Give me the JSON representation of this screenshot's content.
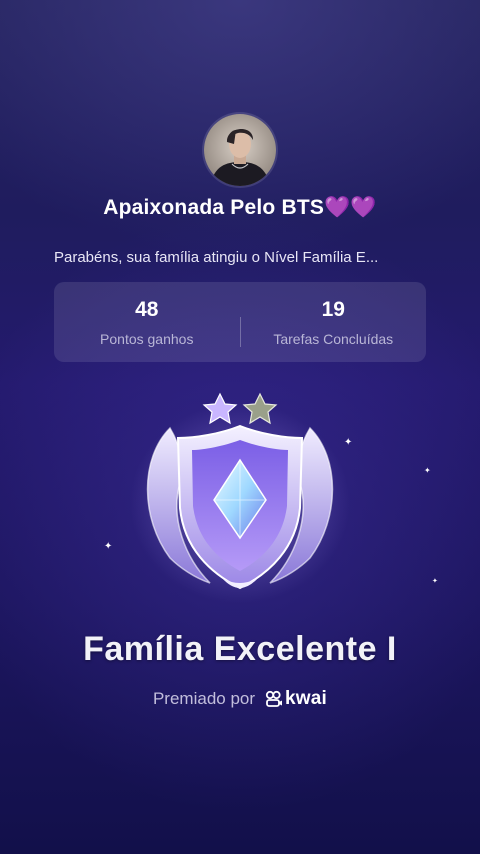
{
  "profile": {
    "username": "Apaixonada Pelo BTS💜💜",
    "avatar_icon": "profile-photo"
  },
  "message": "Parabéns, sua família atingiu o Nível Família E...",
  "stats": [
    {
      "value": "48",
      "label": "Pontos ganhos"
    },
    {
      "value": "19",
      "label": "Tarefas Concluídas"
    }
  ],
  "badge": {
    "icon": "shield-crystal-badge",
    "stars_total": 2,
    "stars_filled": 1,
    "colors": {
      "shield": "#b9a8f0",
      "crystal": "#8fd4ff",
      "star_filled": "#c9b6ff",
      "star_empty": "#9aa08a"
    }
  },
  "level": {
    "title": "Família Excelente I"
  },
  "awarded_by": {
    "prefix": "Premiado por",
    "brand": "kwai",
    "brand_icon": "kwai-logo-icon"
  },
  "colors": {
    "background_top": "#262560",
    "background_bottom": "#12104a",
    "card": "rgba(255,255,255,0.11)",
    "muted_text": "#b9b6d6"
  }
}
